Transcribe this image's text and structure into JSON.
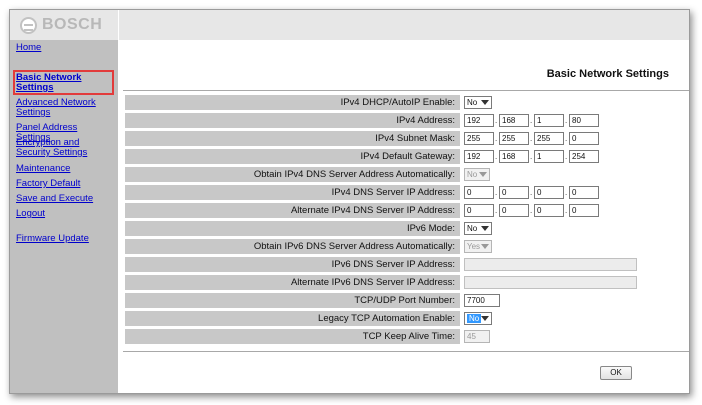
{
  "brand": {
    "logo_text": "BOSCH"
  },
  "sidebar": {
    "items": [
      {
        "label": "Home"
      },
      {
        "label": "Basic Network Settings"
      },
      {
        "label": "Advanced Network Settings"
      },
      {
        "label": "Panel Address Settings"
      },
      {
        "label": "Encryption and Security Settings"
      },
      {
        "label": "Maintenance"
      },
      {
        "label": "Factory Default"
      },
      {
        "label": "Save and Execute"
      },
      {
        "label": "Logout"
      },
      {
        "label": "Firmware Update"
      }
    ],
    "active_index": 1
  },
  "page": {
    "title": "Basic Network Settings"
  },
  "form": {
    "rows": [
      {
        "label": "IPv4 DHCP/AutoIP Enable:",
        "type": "select",
        "value": "No"
      },
      {
        "label": "IPv4 Address:",
        "type": "ip",
        "octets": [
          "192",
          "168",
          "1",
          "80"
        ]
      },
      {
        "label": "IPv4 Subnet Mask:",
        "type": "ip",
        "octets": [
          "255",
          "255",
          "255",
          "0"
        ]
      },
      {
        "label": "IPv4 Default Gateway:",
        "type": "ip",
        "octets": [
          "192",
          "168",
          "1",
          "254"
        ]
      },
      {
        "label": "Obtain IPv4 DNS Server Address Automatically:",
        "type": "select-disabled",
        "value": "No"
      },
      {
        "label": "IPv4 DNS Server IP Address:",
        "type": "ip",
        "octets": [
          "0",
          "0",
          "0",
          "0"
        ]
      },
      {
        "label": "Alternate IPv4 DNS Server IP Address:",
        "type": "ip",
        "octets": [
          "0",
          "0",
          "0",
          "0"
        ]
      },
      {
        "label": "IPv6 Mode:",
        "type": "select",
        "value": "No"
      },
      {
        "label": "Obtain IPv6 DNS Server Address Automatically:",
        "type": "select-disabled",
        "value": "Yes"
      },
      {
        "label": "IPv6 DNS Server IP Address:",
        "type": "text-disabled",
        "value": ""
      },
      {
        "label": "Alternate IPv6 DNS Server IP Address:",
        "type": "text-disabled",
        "value": ""
      },
      {
        "label": "TCP/UDP Port Number:",
        "type": "text",
        "value": "7700"
      },
      {
        "label": "Legacy TCP Automation Enable:",
        "type": "select-highlight",
        "value": "No"
      },
      {
        "label": "TCP Keep Alive Time:",
        "type": "text-small-disabled",
        "value": "45"
      }
    ]
  },
  "buttons": {
    "ok_label": "OK"
  },
  "colors": {
    "link": "#0000cc",
    "sidebar_bg": "#c0c0c0",
    "label_bg": "#c8c8c8",
    "highlight_border": "#e23b3b"
  }
}
